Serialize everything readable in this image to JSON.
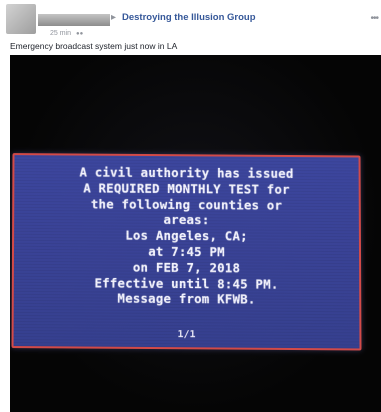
{
  "post": {
    "group_name": "Destroying the Illusion Group",
    "timestamp": "25 min",
    "privacy_icon": "group-audience-icon",
    "more_icon": "more-options-icon",
    "share_arrow_icon": "triangle-right-icon",
    "text": "Emergency broadcast system just now in LA"
  },
  "eas_message": {
    "lines": [
      "A civil authority has issued",
      "A REQUIRED MONTHLY TEST for",
      "the following counties or",
      "areas:",
      "Los Angeles, CA;",
      "at 7:45 PM",
      "on FEB 7, 2018",
      "Effective until 8:45 PM.",
      "Message from KFWB."
    ],
    "page": "1/1"
  },
  "colors": {
    "group_link": "#365899",
    "meta_text": "#90949c",
    "screen_background": "#3a4397",
    "screen_border": "#d24a48",
    "screen_text": "#f4f4ff"
  }
}
